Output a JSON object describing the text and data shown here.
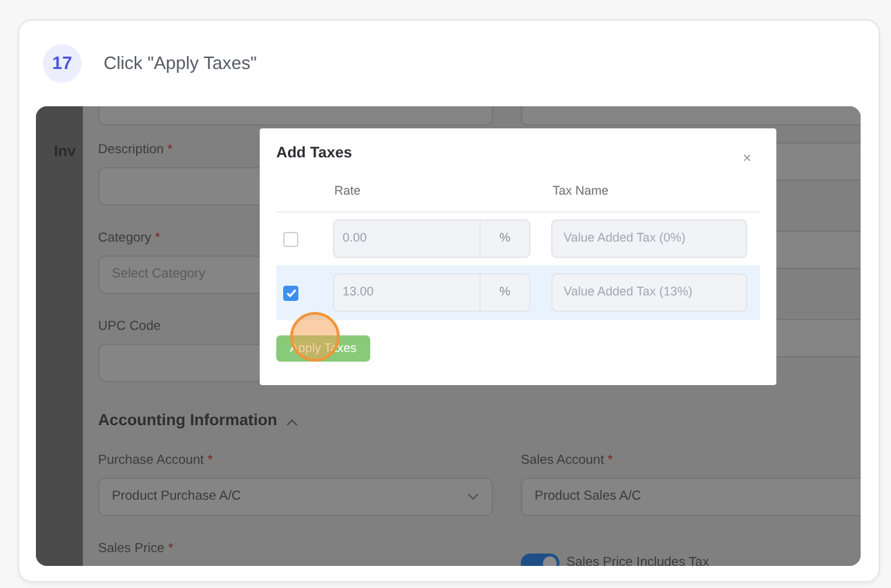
{
  "step": {
    "number": "17",
    "instruction": "Click \"Apply Taxes\""
  },
  "background_page": {
    "heading": "Inv",
    "form_rows": [
      {
        "left": {
          "kind": "text"
        },
        "right": {
          "kind": "text"
        },
        "top_cut": true
      },
      {
        "left": {
          "label": "Description",
          "required_mark": "*",
          "kind": "text"
        },
        "right": {
          "kind": "text"
        }
      },
      {
        "left": {
          "label": "Category",
          "required_mark": "*",
          "kind": "select",
          "placeholder": "Select Category"
        },
        "right": {
          "kind": "text"
        }
      },
      {
        "left": {
          "label": "UPC Code",
          "kind": "text"
        },
        "right": {
          "kind": "text"
        }
      }
    ],
    "section": {
      "title": "Accounting Information",
      "expanded": true
    },
    "section_rows": [
      {
        "left": {
          "label": "Purchase Account",
          "required_mark": "*",
          "kind": "select",
          "value": "Product Purchase A/C"
        },
        "right": {
          "label": "Sales Account",
          "required_mark": "*",
          "kind": "text",
          "value": "Product Sales A/C"
        }
      },
      {
        "left": {
          "label": "Sales Price",
          "required_mark": "*",
          "kind": "text"
        },
        "right": {
          "kind": "toggle",
          "label": "Sales Price Includes Tax",
          "on": true
        }
      }
    ]
  },
  "dialog": {
    "title": "Add Taxes",
    "close": "×",
    "columns": [
      "Rate",
      "Tax Name"
    ],
    "rows": [
      {
        "checked": false,
        "rate": "0.00",
        "unit": "%",
        "tax_name": "Value Added Tax (0%)"
      },
      {
        "checked": true,
        "rate": "13.00",
        "unit": "%",
        "tax_name": "Value Added Tax (13%)"
      }
    ],
    "button": "Apply Taxes"
  },
  "click_marker": true
}
